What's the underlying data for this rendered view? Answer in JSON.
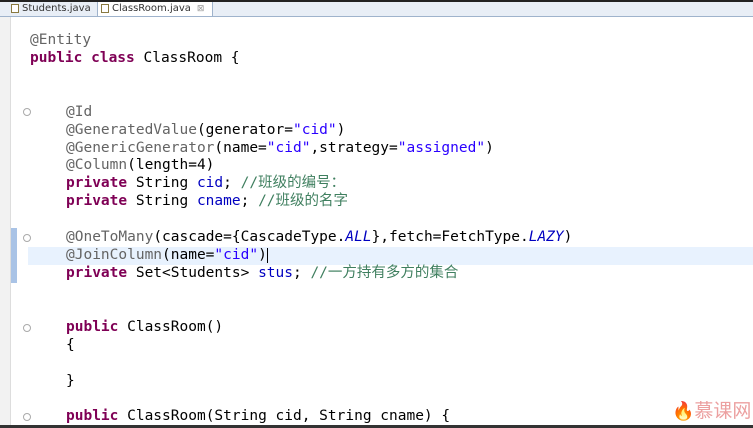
{
  "tabs": [
    {
      "label": "Students.java",
      "close": "⊠"
    },
    {
      "label": "ClassRoom.java",
      "close": "⊠",
      "active": true
    }
  ],
  "code": {
    "l1": "@Entity",
    "l2_kw": "public class",
    "l2_rest": " ClassRoom {",
    "id": "@Id",
    "gv": "@GeneratedValue",
    "gv_a": "(generator=",
    "gv_s": "\"cid\"",
    "gv_e": ")",
    "gg": "@GenericGenerator",
    "gg_a": "(name=",
    "gg_s1": "\"cid\"",
    "gg_b": ",strategy=",
    "gg_s2": "\"assigned\"",
    "gg_e": ")",
    "col": "@Column",
    "col_a": "(length=4)",
    "priv": "private",
    "str_t": " String ",
    "cid": "cid",
    "cid_c": "//班级的编号：",
    "cname": "cname",
    "cname_c": "//班级的名字",
    "otm": "@OneToMany",
    "otm_a": "(cascade={CascadeType.",
    "otm_all": "ALL",
    "otm_b": "},fetch=FetchType.",
    "otm_lazy": "LAZY",
    "otm_e": ")",
    "jc": "@JoinColumn",
    "jc_a": "(name=",
    "jc_s": "\"cid\"",
    "jc_e": ")",
    "set_t": " Set<Students> ",
    "stus": "stus",
    "stus_c": "//一方持有多方的集合",
    "pub": "public",
    "ctor1": " ClassRoom()",
    "open": "{",
    "close": "}",
    "ctor2": " ClassRoom(String cid, String cname) {",
    "semi": "; "
  },
  "watermark": "慕课网",
  "colors": {
    "keyword": "#7f0055",
    "annotation": "#646464",
    "string": "#2a00ff",
    "field": "#0000c0",
    "comment": "#3f7f5f"
  }
}
